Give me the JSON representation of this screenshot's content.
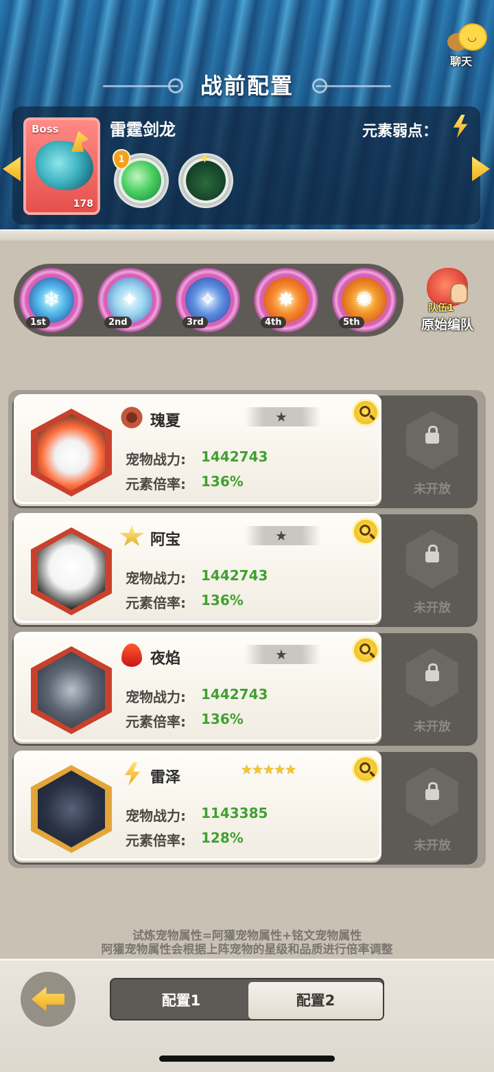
{
  "header": {
    "title": "战前配置",
    "chat_label": "聊天"
  },
  "boss": {
    "tag": "Boss",
    "name": "雷霆剑龙",
    "level": "178",
    "weakness_label": "元素弱点：",
    "weakness_icon": "lightning-bolt-icon",
    "skills": [
      {
        "badge": "1",
        "icon": "wind-slash-skill-icon"
      },
      {
        "badge": "",
        "icon": "green-heal-skill-icon"
      }
    ]
  },
  "order": {
    "slots": [
      {
        "label": "1st",
        "icon": "snowflake-icon",
        "glyph": "❄"
      },
      {
        "label": "2nd",
        "icon": "ice-crystal-icon",
        "glyph": "✦"
      },
      {
        "label": "3rd",
        "icon": "ice-blade-icon",
        "glyph": "✧"
      },
      {
        "label": "4th",
        "icon": "fire-slash-icon",
        "glyph": "✸"
      },
      {
        "label": "5th",
        "icon": "flame-orb-icon",
        "glyph": "✺"
      }
    ],
    "original_team_tag": "队伍1",
    "original_team_label": "原始编队"
  },
  "pets": [
    {
      "name": "瑰夏",
      "element": "gear-element-icon",
      "stars": 1,
      "power_label": "宠物战力:",
      "power": "1442743",
      "rate_label": "元素倍率:",
      "rate": "136%"
    },
    {
      "name": "阿宝",
      "element": "light-element-icon",
      "stars": 1,
      "power_label": "宠物战力:",
      "power": "1442743",
      "rate_label": "元素倍率:",
      "rate": "136%"
    },
    {
      "name": "夜焰",
      "element": "fire-element-icon",
      "stars": 1,
      "power_label": "宠物战力:",
      "power": "1442743",
      "rate_label": "元素倍率:",
      "rate": "136%"
    },
    {
      "name": "雷泽",
      "element": "lightning-element-icon",
      "stars": 5,
      "power_label": "宠物战力:",
      "power": "1143385",
      "rate_label": "元素倍率:",
      "rate": "128%"
    }
  ],
  "locked_label": "未开放",
  "notes": {
    "line1": "试炼宠物属性=阿獾宠物属性+铭文宠物属性",
    "line2": "阿獾宠物属性会根据上阵宠物的星级和品质进行倍率调整"
  },
  "footer": {
    "config1": "配置1",
    "config2": "配置2",
    "selected": "配置2"
  }
}
